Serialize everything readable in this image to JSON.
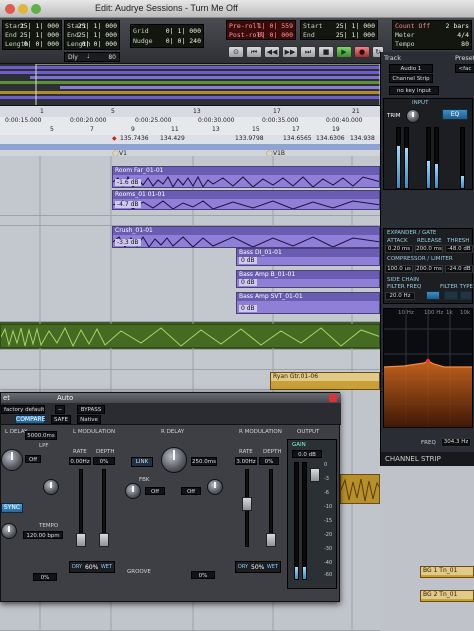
{
  "window": {
    "title": "Edit: Audrye Sessions - Turn Me Off"
  },
  "transport": {
    "main_counter": {
      "rows": [
        {
          "k": "Start",
          "v": "25| 1| 000"
        },
        {
          "k": "End",
          "v": "25| 1| 000"
        },
        {
          "k": "Length",
          "v": "0| 0| 000"
        }
      ]
    },
    "sel_counter": {
      "rows": [
        {
          "k": "Start",
          "v": "25| 1| 000"
        },
        {
          "k": "End",
          "v": "25| 1| 000"
        },
        {
          "k": "Length",
          "v": "0| 0| 000"
        }
      ]
    },
    "dly_label": "Dly",
    "tempo_value": "80",
    "grid": {
      "label": "Grid",
      "value": "0| 1| 000"
    },
    "nudge": {
      "label": "Nudge",
      "value": "0| 0| 240"
    },
    "preroll": {
      "label": "Pre-roll",
      "value": "1| 0| 559"
    },
    "postroll": {
      "label": "Post-roll",
      "value": "0| 0| 000"
    },
    "from": {
      "label": "Start",
      "value": "25| 1| 000"
    },
    "to": {
      "label": "End",
      "value": "25| 1| 000"
    },
    "length": {
      "label": "Length",
      "value": "0| 0| 000"
    },
    "countoff": {
      "label": "Count Off",
      "value": "2 bars"
    },
    "meter": {
      "label": "Meter",
      "value": "4/4"
    },
    "tempo": {
      "label": "Tempo",
      "value": "80"
    }
  },
  "ruler": {
    "bars": [
      "1",
      "5",
      "9",
      "13",
      "17",
      "21"
    ],
    "minsecs": [
      "0:00:15.000",
      "0:00:20.000",
      "0:00:25.000",
      "0:00:30.000",
      "0:00:35.000",
      "0:00:40.000",
      "0:00:45.000",
      "0:00:50.000"
    ],
    "bar_numbers": [
      "5",
      "7",
      "9",
      "11",
      "13",
      "15",
      "17",
      "19",
      "21",
      "23"
    ],
    "tempos": [
      "135.7436",
      "134.429",
      "133.9798",
      "134.6565",
      "134.6306",
      "134.938"
    ],
    "markers": [
      "V1",
      "V1B"
    ]
  },
  "clips": [
    {
      "name": "Room Far_01-01",
      "gain": "-1.6 dB"
    },
    {
      "name": "Rooms_01 01-01",
      "gain": "-4.7 dB"
    },
    {
      "name": "Crush_01-01",
      "gain": "-3.3 dB"
    },
    {
      "name": "Bass DI_01-01",
      "gain": "0 dB"
    },
    {
      "name": "Bass Amp B_01-01",
      "gain": "0 dB"
    },
    {
      "name": "Bass Amp SVT_01-01",
      "gain": "0 dB"
    },
    {
      "name": "Ryan Gtr.01-06",
      "gain": ""
    },
    {
      "name": "BG 1 Tn_01",
      "gain": ""
    },
    {
      "name": "BG 2 Tn_01",
      "gain": ""
    }
  ],
  "strip": {
    "track_label": "Track",
    "preset_label": "Preset",
    "track_value": "Audio 1",
    "preset_value": "<fac",
    "plugin_name": "Channel Strip",
    "key_input": "no key input",
    "input_label": "INPUT",
    "trim_label": "TRIM",
    "trim_value": "0.0 dB",
    "eq_btn": "EQ",
    "dyn_label": "DYNAMICS",
    "sc_label": "SIDE CHAIN",
    "expander": "EXPANDER / GATE",
    "attack_l": "ATTACK",
    "release_l": "RELEASE",
    "thresh_l": "THRESH",
    "exp_vals": [
      "0.20 ms",
      "200.0 ms",
      "-48.0 dB"
    ],
    "comp": "COMPRESSOR / LIMITER",
    "comp_vals": [
      "100.0 us",
      "200.0 ms",
      "-24.0 dB"
    ],
    "side_chain": "SIDE CHAIN",
    "filter_freq_l": "FILTER FREQ",
    "filter_type_l": "FILTER TYPE",
    "filter_freq": "20.0 Hz",
    "freq_labels": [
      "10 Hz",
      "100 Hz",
      "1k",
      "10k"
    ],
    "freq_label": "FREQ",
    "freq_value": "304.3 Hz",
    "footer": "CHANNEL STRIP"
  },
  "plugin": {
    "title_left": "et",
    "title_right": "Auto",
    "preset": "factory default>",
    "bypass": "BYPASS",
    "compare": "COMPARE",
    "safe": "SAFE",
    "native": "Native",
    "sec_ldelay": "L DELAY",
    "sec_lmod": "L MODULATION",
    "sec_rdelay": "R DELAY",
    "sec_rmod": "R MODULATION",
    "sec_output": "OUTPUT",
    "ldelay_ms": "5000.0ms",
    "rdelay_ms": "250.0ms",
    "lpf_label": "LPF",
    "lpf_val": "Off",
    "hpf_val": "Off",
    "rate_label": "RATE",
    "depth_label": "DEPTH",
    "rate_val": "0.00Hz",
    "depth_val": "0%",
    "rate_val2": "3.00Hz",
    "depth_val2": "0%",
    "link": "LINK",
    "fbk": "FBK",
    "sync": "SYNC",
    "tempo_label": "TEMPO",
    "tempo_val": "120.00 bpm",
    "mix_val": "0%",
    "groove_label": "GROOVE",
    "groove_val": "0%",
    "gain_label": "GAIN",
    "gain_val": "0.0 dB",
    "dry_label": "DRY",
    "wet_label": "WET",
    "mix_pct1": "60%",
    "mix_pct2": "50%",
    "scale": [
      "0",
      "-3",
      "-6",
      "-10",
      "-15",
      "-20",
      "-30",
      "-40",
      "-60"
    ]
  }
}
